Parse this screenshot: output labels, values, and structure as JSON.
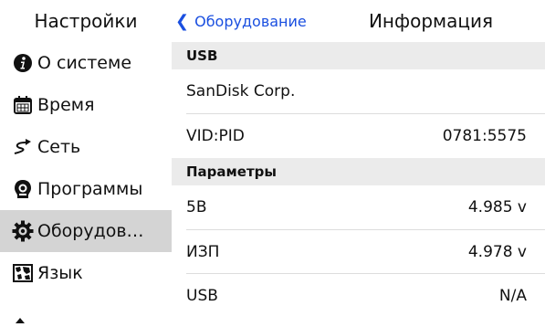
{
  "header": {
    "sidebar_title": "Настройки",
    "back_label": "Оборудование",
    "back_icon": "chevron-left-icon",
    "page_title": "Информация",
    "accent_color": "#1a4fe0"
  },
  "sidebar": {
    "items": [
      {
        "label": "О системе",
        "icon": "info-icon"
      },
      {
        "label": "Время",
        "icon": "calendar-icon"
      },
      {
        "label": "Сеть",
        "icon": "network-icon"
      },
      {
        "label": "Программы",
        "icon": "apps-icon"
      },
      {
        "label": "Оборудов…",
        "icon": "gear-icon",
        "selected": true
      },
      {
        "label": "Язык",
        "icon": "map-icon"
      }
    ]
  },
  "detail": {
    "usb_header": "USB",
    "vendor": "SanDisk Corp.",
    "vidpid_label": "VID:PID",
    "vidpid_value": "0781:5575",
    "params_header": "Параметры",
    "params": [
      {
        "label": "5В",
        "value": "4.985 v"
      },
      {
        "label": "ИЗП",
        "value": "4.978 v"
      },
      {
        "label": "USB",
        "value": "N/A"
      }
    ]
  }
}
